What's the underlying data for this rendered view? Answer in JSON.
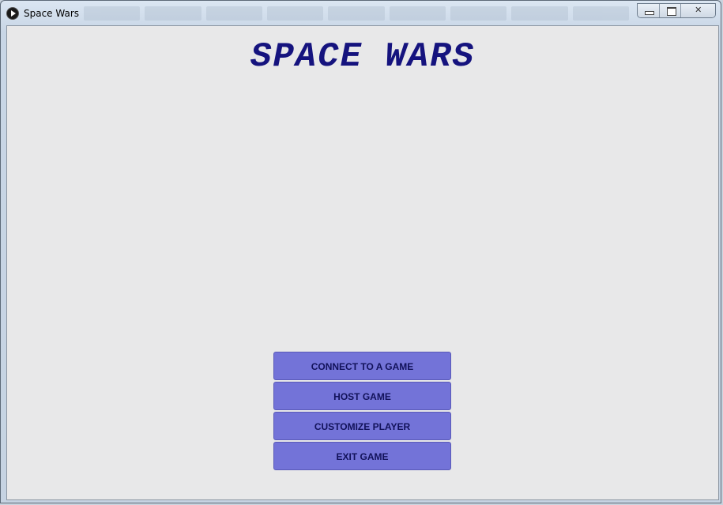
{
  "window": {
    "title": "Space Wars",
    "controls": {
      "minimize_icon": "minimize-icon",
      "maximize_icon": "maximize-icon",
      "close_label": "✕"
    }
  },
  "game": {
    "title": "SPACE WARS",
    "title_color": "#15137e"
  },
  "menu": {
    "button_color": "#7373d8",
    "items": [
      {
        "label": "CONNECT TO A GAME"
      },
      {
        "label": "HOST GAME"
      },
      {
        "label": "CUSTOMIZE PLAYER"
      },
      {
        "label": "EXIT GAME"
      }
    ]
  }
}
